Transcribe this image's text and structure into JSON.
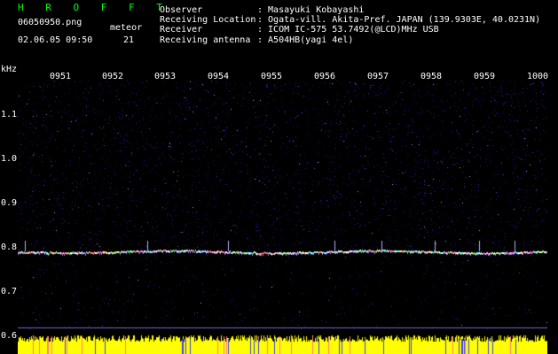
{
  "header": {
    "program": "H R O F F T",
    "filename": "06050950.png",
    "datetime": "02.06.05 09:50",
    "meteor_label": "meteor",
    "meteor_count": "21"
  },
  "info": {
    "observer_label": "Observer",
    "observer_value": ": Masayuki Kobayashi",
    "location_label": "Receiving Location",
    "location_value": ": Ogata-vill. Akita-Pref. JAPAN (139.9303E, 40.0231N)",
    "receiver_label": "Receiver",
    "receiver_value": ": ICOM IC-575 53.7492(@LCD)MHz USB",
    "antenna_label": "Receiving antenna",
    "antenna_value": ": A504HB(yagi 4el)"
  },
  "axis": {
    "unit": "kHz",
    "y_ticks": [
      "1.1",
      "1.0",
      "0.9",
      "0.8",
      "0.7",
      "0.6"
    ],
    "x_ticks": [
      "0951",
      "0952",
      "0953",
      "0954",
      "0955",
      "0956",
      "0957",
      "0958",
      "0959",
      "1000"
    ]
  },
  "colors": {
    "header_green": "#00ff00",
    "background": "#000000",
    "noise": "#1a1aa0",
    "trace": "#ffffff",
    "bottom_bar": "#ffff00"
  }
}
